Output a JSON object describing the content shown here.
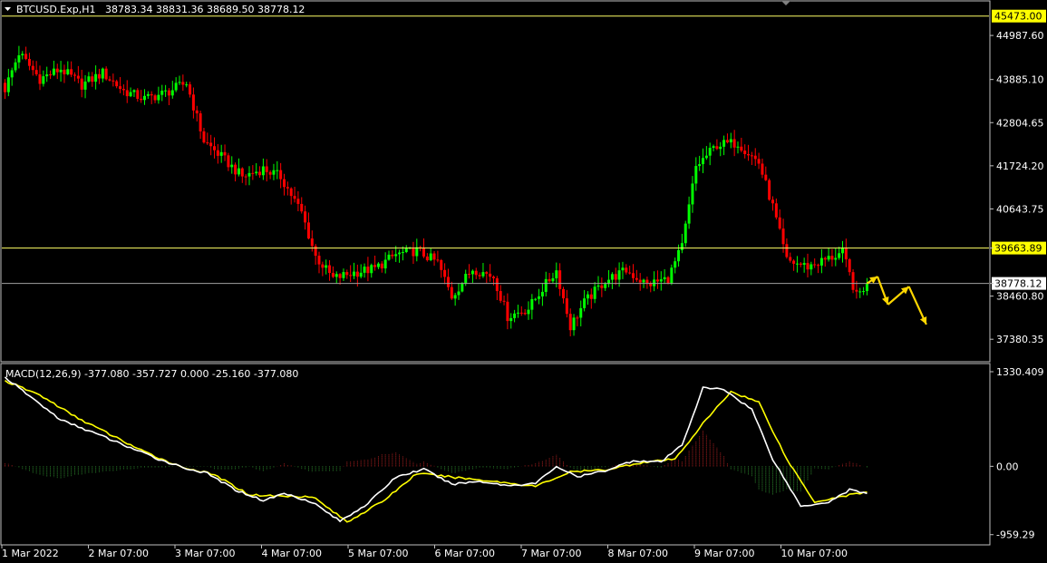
{
  "header": {
    "symbol": "BTCUSD.Exp,H1",
    "ohlc": "38783.34 38831.36 38689.50 38778.12"
  },
  "macd_header": {
    "label": "MACD(12,26,9) -377.080 -357.727 0.000 -25.160 -377.080"
  },
  "colors": {
    "background": "#000000",
    "bull": "#00ff00",
    "bear": "#ff0000",
    "macd_main": "#ffffff",
    "macd_signal": "#ffff00",
    "level_line": "#ffff66",
    "current_line": "#a0a0a0",
    "forecast_arrow": "#ffd700",
    "hist_pos": "#b22222",
    "hist_neg": "#2e8b2e"
  },
  "chart_data": [
    {
      "type": "candlestick",
      "name": "BTCUSD.Exp,H1",
      "ylim": [
        36840,
        45830
      ],
      "y_ticks": [
        "44987.60",
        "43885.10",
        "42804.65",
        "41724.20",
        "40643.75",
        "39663.89",
        "38778.12",
        "38460.80",
        "37380.35"
      ],
      "x_ticks": [
        "1 Mar 2022",
        "2 Mar 07:00",
        "3 Mar 07:00",
        "4 Mar 07:00",
        "5 Mar 07:00",
        "6 Mar 07:00",
        "7 Mar 07:00",
        "8 Mar 07:00",
        "9 Mar 07:00",
        "10 Mar 07:00"
      ],
      "levels": [
        {
          "value": 45473.0,
          "label": "45473.00"
        },
        {
          "value": 39663.89,
          "label": "39663.89"
        }
      ],
      "current_price": {
        "value": 38778.12,
        "label": "38778.12"
      },
      "close_path": [
        {
          "bar": 0,
          "close": 43650
        },
        {
          "bar": 4,
          "close": 44550
        },
        {
          "bar": 10,
          "close": 43900
        },
        {
          "bar": 16,
          "close": 44150
        },
        {
          "bar": 22,
          "close": 43750
        },
        {
          "bar": 28,
          "close": 44050
        },
        {
          "bar": 34,
          "close": 43600
        },
        {
          "bar": 40,
          "close": 43400
        },
        {
          "bar": 46,
          "close": 43550
        },
        {
          "bar": 52,
          "close": 43800
        },
        {
          "bar": 57,
          "close": 42350
        },
        {
          "bar": 62,
          "close": 41950
        },
        {
          "bar": 68,
          "close": 41450
        },
        {
          "bar": 74,
          "close": 41650
        },
        {
          "bar": 79,
          "close": 41450
        },
        {
          "bar": 85,
          "close": 40550
        },
        {
          "bar": 89,
          "close": 39450
        },
        {
          "bar": 94,
          "close": 38900
        },
        {
          "bar": 100,
          "close": 39050
        },
        {
          "bar": 106,
          "close": 39150
        },
        {
          "bar": 112,
          "close": 39500
        },
        {
          "bar": 118,
          "close": 39600
        },
        {
          "bar": 124,
          "close": 39300
        },
        {
          "bar": 128,
          "close": 38450
        },
        {
          "bar": 134,
          "close": 39150
        },
        {
          "bar": 140,
          "close": 38950
        },
        {
          "bar": 144,
          "close": 37950
        },
        {
          "bar": 150,
          "close": 38150
        },
        {
          "bar": 154,
          "close": 38650
        },
        {
          "bar": 158,
          "close": 39100
        },
        {
          "bar": 162,
          "close": 37700
        },
        {
          "bar": 166,
          "close": 38300
        },
        {
          "bar": 172,
          "close": 38850
        },
        {
          "bar": 178,
          "close": 39100
        },
        {
          "bar": 184,
          "close": 38750
        },
        {
          "bar": 190,
          "close": 38900
        },
        {
          "bar": 194,
          "close": 39700
        },
        {
          "bar": 198,
          "close": 41700
        },
        {
          "bar": 204,
          "close": 42250
        },
        {
          "bar": 210,
          "close": 42300
        },
        {
          "bar": 216,
          "close": 41800
        },
        {
          "bar": 220,
          "close": 40700
        },
        {
          "bar": 224,
          "close": 39350
        },
        {
          "bar": 230,
          "close": 39200
        },
        {
          "bar": 236,
          "close": 39400
        },
        {
          "bar": 240,
          "close": 39550
        },
        {
          "bar": 244,
          "close": 38450
        },
        {
          "bar": 247,
          "close": 38778
        }
      ],
      "forecast": [
        {
          "bar": 247,
          "price": 38778
        },
        {
          "bar": 250,
          "price": 38950
        },
        {
          "bar": 253,
          "price": 38250
        },
        {
          "bar": 259,
          "price": 38700
        },
        {
          "bar": 264,
          "price": 37750
        }
      ]
    },
    {
      "type": "macd",
      "name": "MACD(12,26,9)",
      "ylim": [
        -1090,
        1430
      ],
      "y_ticks": [
        "1330.409",
        "0.00",
        "-959.29"
      ],
      "main_path": [
        {
          "bar": 0,
          "value": 1250
        },
        {
          "bar": 8,
          "value": 950
        },
        {
          "bar": 16,
          "value": 650
        },
        {
          "bar": 24,
          "value": 500
        },
        {
          "bar": 34,
          "value": 300
        },
        {
          "bar": 44,
          "value": 100
        },
        {
          "bar": 52,
          "value": -30
        },
        {
          "bar": 58,
          "value": -100
        },
        {
          "bar": 66,
          "value": -330
        },
        {
          "bar": 74,
          "value": -480
        },
        {
          "bar": 80,
          "value": -380
        },
        {
          "bar": 88,
          "value": -500
        },
        {
          "bar": 96,
          "value": -770
        },
        {
          "bar": 104,
          "value": -520
        },
        {
          "bar": 112,
          "value": -150
        },
        {
          "bar": 120,
          "value": -40
        },
        {
          "bar": 128,
          "value": -250
        },
        {
          "bar": 136,
          "value": -210
        },
        {
          "bar": 144,
          "value": -270
        },
        {
          "bar": 152,
          "value": -240
        },
        {
          "bar": 158,
          "value": 0
        },
        {
          "bar": 164,
          "value": -150
        },
        {
          "bar": 172,
          "value": -60
        },
        {
          "bar": 180,
          "value": 80
        },
        {
          "bar": 188,
          "value": 60
        },
        {
          "bar": 194,
          "value": 300
        },
        {
          "bar": 200,
          "value": 1100
        },
        {
          "bar": 206,
          "value": 1080
        },
        {
          "bar": 214,
          "value": 800
        },
        {
          "bar": 220,
          "value": 100
        },
        {
          "bar": 228,
          "value": -560
        },
        {
          "bar": 236,
          "value": -500
        },
        {
          "bar": 242,
          "value": -330
        },
        {
          "bar": 247,
          "value": -377
        }
      ],
      "signal_path": [
        {
          "bar": 0,
          "value": 1200
        },
        {
          "bar": 10,
          "value": 1000
        },
        {
          "bar": 20,
          "value": 700
        },
        {
          "bar": 30,
          "value": 450
        },
        {
          "bar": 40,
          "value": 200
        },
        {
          "bar": 50,
          "value": 0
        },
        {
          "bar": 60,
          "value": -120
        },
        {
          "bar": 70,
          "value": -400
        },
        {
          "bar": 80,
          "value": -420
        },
        {
          "bar": 88,
          "value": -420
        },
        {
          "bar": 98,
          "value": -780
        },
        {
          "bar": 108,
          "value": -500
        },
        {
          "bar": 118,
          "value": -100
        },
        {
          "bar": 128,
          "value": -150
        },
        {
          "bar": 140,
          "value": -210
        },
        {
          "bar": 152,
          "value": -280
        },
        {
          "bar": 162,
          "value": -80
        },
        {
          "bar": 172,
          "value": -50
        },
        {
          "bar": 182,
          "value": 50
        },
        {
          "bar": 192,
          "value": 100
        },
        {
          "bar": 200,
          "value": 600
        },
        {
          "bar": 208,
          "value": 1050
        },
        {
          "bar": 216,
          "value": 900
        },
        {
          "bar": 224,
          "value": 100
        },
        {
          "bar": 232,
          "value": -500
        },
        {
          "bar": 240,
          "value": -420
        },
        {
          "bar": 247,
          "value": -358
        }
      ]
    }
  ]
}
